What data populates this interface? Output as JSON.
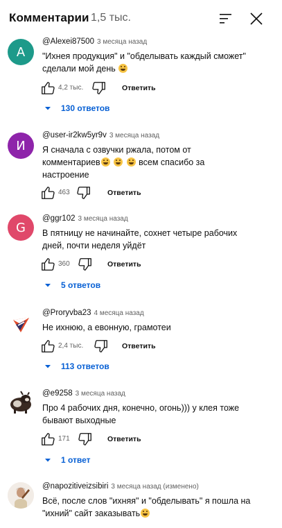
{
  "header": {
    "title": "Комментарии",
    "count": "1,5 тыс."
  },
  "comments": [
    {
      "author": "@Alexei87500",
      "time": "3 месяца назад",
      "avatar_letter": "A",
      "avatar_color": "#1d9a8a",
      "text_parts": [
        "\"Ихнея продукция\" и \"обделывать каждый сможет\" сделали мой день "
      ],
      "emoji_count": 1,
      "likes": "4,2 тыс.",
      "reply_label": "Ответить",
      "replies_label": "130 ответов"
    },
    {
      "author": "@user-ir2kw5yr9v",
      "time": "3 месяца назад",
      "avatar_letter": "И",
      "avatar_color": "#8e24aa",
      "text_parts": [
        "Я сначала с озвучки ржала, потом от комментариев",
        "всем спасибо за настроение"
      ],
      "emoji_count": 3,
      "likes": "463",
      "reply_label": "Ответить",
      "replies_label": ""
    },
    {
      "author": "@ggr102",
      "time": "3 месяца назад",
      "avatar_letter": "G",
      "avatar_color": "#e0486a",
      "text_parts": [
        "В пятницу не начинайте, сохнет четыре рабочих дней, почти неделя уйдёт"
      ],
      "emoji_count": 0,
      "likes": "360",
      "reply_label": "Ответить",
      "replies_label": "5 ответов"
    },
    {
      "author": "@Proryvba23",
      "time": "4 месяца назад",
      "avatar_letter": "",
      "avatar_color": "#ffffff",
      "text_parts": [
        "Не ихнюю, а евонную, грамотеи"
      ],
      "emoji_count": 0,
      "likes": "2,4 тыс.",
      "reply_label": "Ответить",
      "replies_label": "113 ответов"
    },
    {
      "author": "@e9258",
      "time": "3 месяца назад",
      "avatar_letter": "",
      "avatar_color": "#ffffff",
      "text_parts": [
        "Про 4 рабочих дня, конечно, огонь))) у клея тоже бывают выходные"
      ],
      "emoji_count": 0,
      "likes": "171",
      "reply_label": "Ответить",
      "replies_label": "1 ответ"
    },
    {
      "author": "@napozitiveizsibiri",
      "time": "3 месяца назад (изменено)",
      "avatar_letter": "",
      "avatar_color": "#ffffff",
      "text_parts": [
        "Всё, после слов \"ихняя\" и \"обделывать\" я пошла на \"ихний\" сайт заказывать"
      ],
      "emoji_count": 1,
      "likes": "",
      "reply_label": "",
      "replies_label": ""
    }
  ],
  "colors": {
    "link_blue": "#065fd4",
    "secondary_text": "#606060"
  },
  "icons": {
    "sort": "sort-icon",
    "close": "close-icon",
    "like": "thumb-up-icon",
    "dislike": "thumb-down-icon",
    "expand": "chevron-down-icon"
  }
}
